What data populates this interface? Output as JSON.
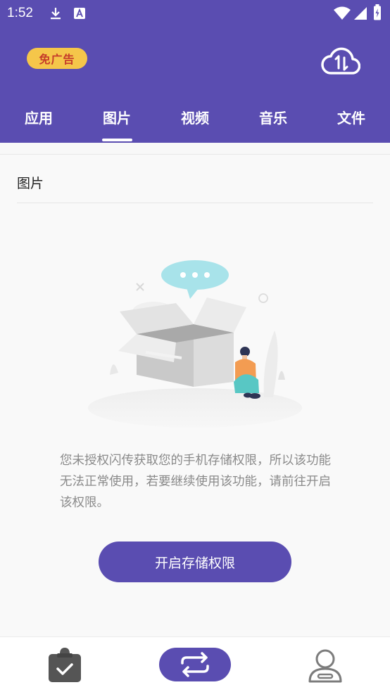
{
  "status_bar": {
    "time": "1:52",
    "icons": [
      "download-icon",
      "a-notification-icon",
      "wifi-icon",
      "cellular-icon",
      "battery-icon"
    ]
  },
  "header": {
    "ad_badge_label": "免广告",
    "cloud_icon": "cloud-transfer-icon",
    "tabs": [
      {
        "label": "应用"
      },
      {
        "label": "图片"
      },
      {
        "label": "视频"
      },
      {
        "label": "音乐"
      },
      {
        "label": "文件"
      }
    ],
    "active_tab": "图片"
  },
  "content": {
    "section_title": "图片",
    "illustration": "empty-box-person-illustration",
    "permission_message": "您未授权闪传获取您的手机存储权限，所以该功能无法正常使用，若要继续使用该功能，请前往开启该权限。",
    "cta_label": "开启存储权限"
  },
  "bottom_nav": {
    "items": [
      "clipboard-icon",
      "transfer-swap-icon",
      "profile-icon"
    ]
  },
  "colors": {
    "primary": "#5a4db1",
    "badge": "#f5c64a",
    "text_muted": "#8a8a8a"
  }
}
